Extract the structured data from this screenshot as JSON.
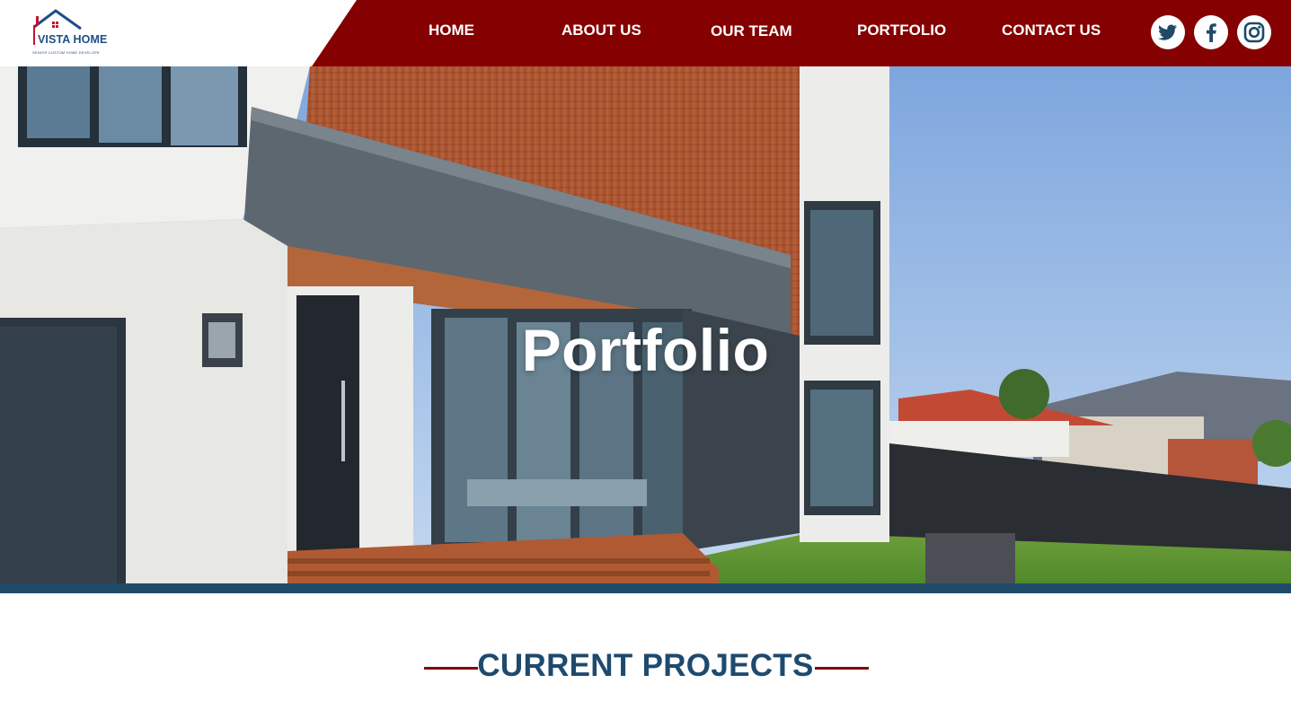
{
  "brand": {
    "name": "VISTA HOME",
    "tagline": "SENIOR CUSTOM HOME DEVELOPE",
    "colors": {
      "primary": "#850000",
      "navy": "#1f4a68",
      "logo_blue": "#1e4f86"
    }
  },
  "nav": {
    "items": [
      {
        "label": "HOME"
      },
      {
        "label": "ABOUT US"
      },
      {
        "label": "OUR TEAM"
      },
      {
        "label": "PORTFOLIO"
      },
      {
        "label": "CONTACT US"
      }
    ]
  },
  "social": [
    {
      "icon": "twitter-icon"
    },
    {
      "icon": "facebook-icon"
    },
    {
      "icon": "instagram-icon"
    }
  ],
  "hero": {
    "title": "Portfolio"
  },
  "section": {
    "title": "CURRENT PROJECTS"
  }
}
